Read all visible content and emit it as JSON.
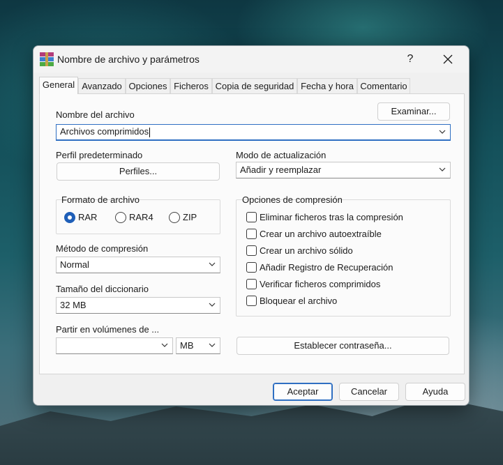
{
  "window": {
    "title": "Nombre de archivo y parámetros",
    "help": "?"
  },
  "tabs": [
    "General",
    "Avanzado",
    "Opciones",
    "Ficheros",
    "Copia de seguridad",
    "Fecha y hora",
    "Comentario"
  ],
  "archive_name": {
    "label": "Nombre del archivo",
    "value": "Archivos comprimidos",
    "browse_button": "Examinar..."
  },
  "profile": {
    "label": "Perfil predeterminado",
    "button": "Perfiles..."
  },
  "update_mode": {
    "label": "Modo de actualización",
    "value": "Añadir y reemplazar"
  },
  "archive_format": {
    "label": "Formato de archivo",
    "options": [
      "RAR",
      "RAR4",
      "ZIP"
    ],
    "selected": "RAR"
  },
  "compression_method": {
    "label": "Método de compresión",
    "value": "Normal"
  },
  "dictionary_size": {
    "label": "Tamaño del diccionario",
    "value": "32 MB"
  },
  "split_volumes": {
    "label": "Partir en volúmenes de ...",
    "value": "",
    "unit": "MB"
  },
  "compression_options": {
    "label": "Opciones de compresión",
    "items": [
      "Eliminar ficheros tras la compresión",
      "Crear un archivo autoextraíble",
      "Crear un archivo sólido",
      "Añadir Registro de Recuperación",
      "Verificar ficheros comprimidos",
      "Bloquear el archivo"
    ]
  },
  "password_button": "Establecer contraseña...",
  "footer": {
    "ok": "Aceptar",
    "cancel": "Cancelar",
    "help": "Ayuda"
  },
  "colors": {
    "accent": "#2f6fc2"
  }
}
